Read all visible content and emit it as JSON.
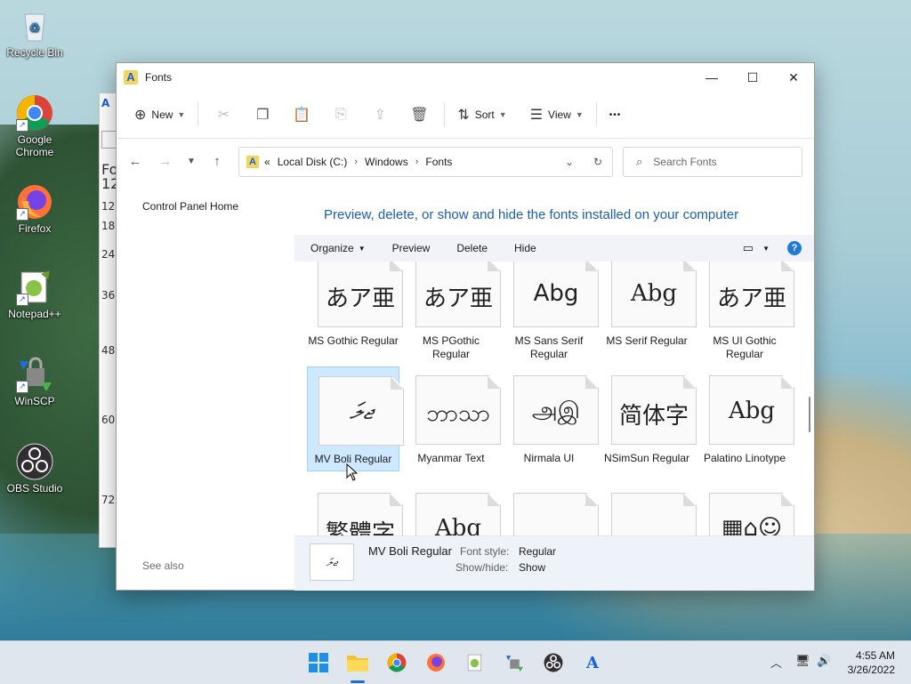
{
  "desktop": {
    "icons": [
      {
        "label": "Recycle Bin"
      },
      {
        "label": "Google Chrome"
      },
      {
        "label": "Firefox"
      },
      {
        "label": "Notepad++"
      },
      {
        "label": "WinSCP"
      },
      {
        "label": "OBS Studio"
      }
    ]
  },
  "background_window": {
    "lines": [
      "Fo",
      "12",
      "12",
      "18",
      "24",
      "36",
      "48",
      "60",
      "72"
    ]
  },
  "window": {
    "title": "Fonts",
    "toolbar": {
      "new_label": "New",
      "sort_label": "Sort",
      "view_label": "View",
      "more_label": "•••"
    },
    "address": {
      "prefix": "«",
      "crumbs": [
        "Local Disk (C:)",
        "Windows",
        "Fonts"
      ]
    },
    "search": {
      "placeholder": "Search Fonts"
    },
    "left_pane": {
      "control_panel_home": "Control Panel Home",
      "see_also": "See also"
    },
    "heading": "Preview, delete, or show and hide the fonts installed on your computer",
    "commands": {
      "organize": "Organize",
      "preview": "Preview",
      "delete": "Delete",
      "hide": "Hide"
    },
    "fonts": [
      {
        "sample": "あア亜",
        "name": "MS Gothic Regular",
        "style": "sans",
        "stack": false
      },
      {
        "sample": "あア亜",
        "name": "MS PGothic Regular",
        "style": "sans",
        "stack": false
      },
      {
        "sample": "Abg",
        "name": "MS Sans Serif Regular",
        "style": "sans",
        "stack": false
      },
      {
        "sample": "Abg",
        "name": "MS Serif Regular",
        "style": "serif",
        "stack": false
      },
      {
        "sample": "あア亜",
        "name": "MS UI Gothic Regular",
        "style": "sans",
        "stack": false
      },
      {
        "sample": "ޖލަ",
        "name": "MV Boli Regular",
        "style": "script",
        "stack": false,
        "selected": true
      },
      {
        "sample": "ဘာသာ",
        "name": "Myanmar Text",
        "style": "sans",
        "stack": true
      },
      {
        "sample": "அஇ",
        "name": "Nirmala UI",
        "style": "sans",
        "stack": true
      },
      {
        "sample": "简体字",
        "name": "NSimSun Regular",
        "style": "serif",
        "stack": false
      },
      {
        "sample": "Abg",
        "name": "Palatino Linotype",
        "style": "serif",
        "stack": true
      },
      {
        "sample": "繁體字",
        "name": "",
        "style": "serif",
        "stack": false
      },
      {
        "sample": "Abg",
        "name": "",
        "style": "serif",
        "stack": false
      },
      {
        "sample": "",
        "name": "",
        "style": "sans",
        "stack": false
      },
      {
        "sample": "",
        "name": "",
        "style": "sans",
        "stack": false
      },
      {
        "sample": "▦⌂☺",
        "name": "",
        "style": "sans",
        "stack": false
      }
    ],
    "details": {
      "thumb_sample": "ޖލަ",
      "name": "MV Boli Regular",
      "font_style_label": "Font style:",
      "font_style_value": "Regular",
      "show_hide_label": "Show/hide:",
      "show_hide_value": "Show"
    }
  },
  "taskbar": {
    "time": "4:55 AM",
    "date": "3/26/2022"
  },
  "colors": {
    "accent": "#1f6fd1",
    "heading": "#1a5fa8",
    "selection": "#cde8ff"
  }
}
